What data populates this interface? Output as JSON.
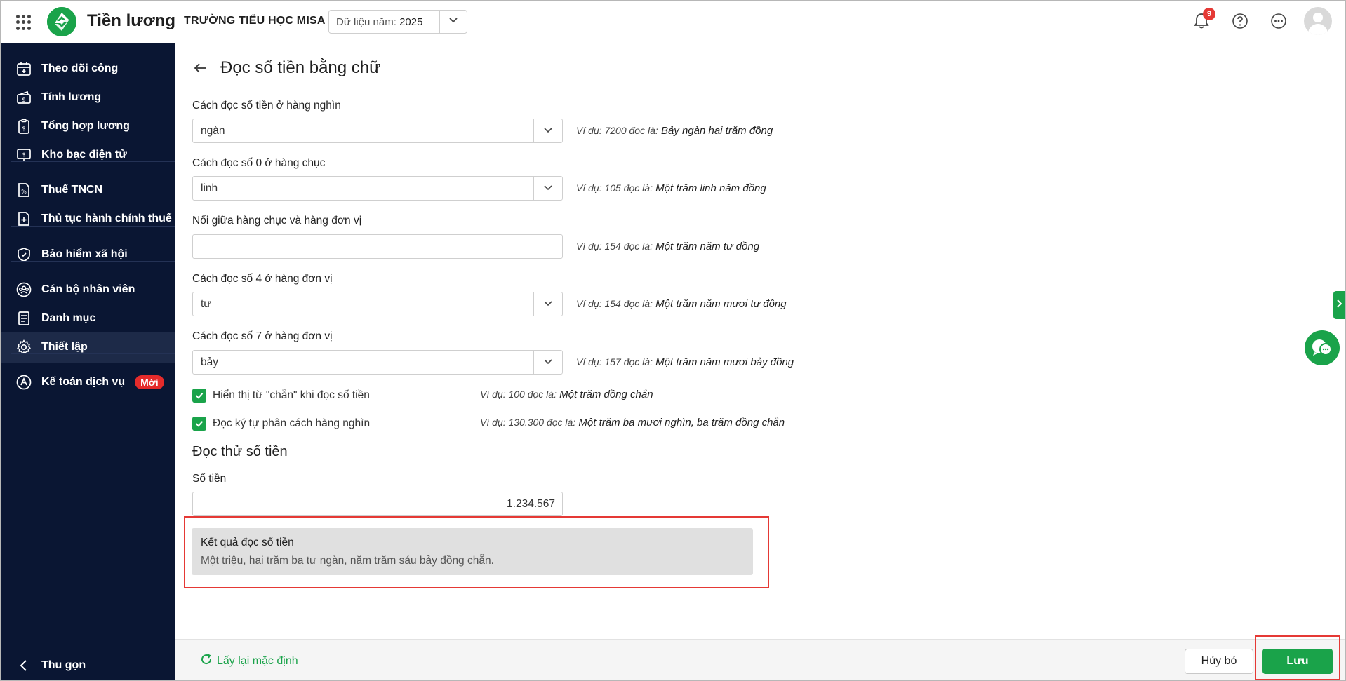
{
  "app": {
    "name": "Tiền lương",
    "org": "TRƯỜNG TIỂU HỌC MISA",
    "year_label": "Dữ liệu năm:",
    "year_value": "2025",
    "notification_count": "9"
  },
  "sidebar": {
    "items": [
      {
        "label": "Theo dõi công",
        "icon": "calendar-icon"
      },
      {
        "label": "Tính lương",
        "icon": "money-icon"
      },
      {
        "label": "Tổng hợp lương",
        "icon": "payroll-summary-icon"
      },
      {
        "label": "Kho bạc điện tử",
        "icon": "treasury-icon"
      },
      {
        "label": "Thuế TNCN",
        "icon": "tax-document-icon"
      },
      {
        "label": "Thủ tục hành chính thuế",
        "icon": "tax-procedure-icon"
      },
      {
        "label": "Bảo hiểm xã hội",
        "icon": "insurance-shield-icon"
      },
      {
        "label": "Cán bộ nhân viên",
        "icon": "staff-group-icon"
      },
      {
        "label": "Danh mục",
        "icon": "catalog-icon"
      },
      {
        "label": "Thiết lập",
        "icon": "settings-gear-icon"
      },
      {
        "label": "Kế toán dịch vụ",
        "icon": "accounting-service-icon",
        "badge": "Mới"
      }
    ],
    "collapse_label": "Thu gọn",
    "active_index": 9
  },
  "page": {
    "title": "Đọc số tiền bằng chữ",
    "fields": [
      {
        "label": "Cách đọc số tiền ở hàng nghìn",
        "value": "ngàn",
        "type": "select",
        "example_prefix": "Ví dụ: 7200 đọc là:",
        "example_result": "Bảy ngàn hai trăm đồng"
      },
      {
        "label": "Cách đọc số 0 ở hàng chục",
        "value": "linh",
        "type": "select",
        "example_prefix": "Ví dụ: 105 đọc là:",
        "example_result": "Một trăm linh năm đồng"
      },
      {
        "label": "Nối giữa hàng chục và hàng đơn vị",
        "value": "",
        "type": "text",
        "example_prefix": "Ví dụ: 154 đọc là:",
        "example_result": "Một trăm năm tư đồng"
      },
      {
        "label": "Cách đọc số 4 ở hàng đơn vị",
        "value": "tư",
        "type": "select",
        "example_prefix": "Ví dụ: 154 đọc là:",
        "example_result": "Một trăm năm mươi tư đồng"
      },
      {
        "label": "Cách đọc số 7 ở hàng đơn vị",
        "value": "bảy",
        "type": "select",
        "example_prefix": "Ví dụ: 157 đọc là:",
        "example_result": "Một trăm năm mươi bảy đồng"
      }
    ],
    "checkboxes": [
      {
        "label": "Hiển thị từ \"chẵn\" khi đọc số tiền",
        "checked": true,
        "example_prefix": "Ví dụ: 100 đọc là:",
        "example_result": "Một trăm đồng chẵn"
      },
      {
        "label": "Đọc ký tự phân cách hàng nghìn",
        "checked": true,
        "example_prefix": "Ví dụ: 130.300 đọc là:",
        "example_result": "Một trăm ba mươi nghìn, ba trăm đồng chẵn"
      }
    ],
    "test_section": {
      "title": "Đọc thử số tiền",
      "amount_label": "Số tiền",
      "amount_value": "1.234.567",
      "result_title": "Kết quả đọc số tiền",
      "result_text": "Một triệu, hai trăm ba tư ngàn, năm trăm sáu bảy đồng chẵn."
    }
  },
  "footer": {
    "reset_label": "Lấy lại mặc định",
    "cancel_label": "Hủy bỏ",
    "save_label": "Lưu"
  },
  "colors": {
    "accent": "#1aa34a",
    "sidebar_bg": "#0a1633",
    "highlight_red": "#e53935"
  }
}
